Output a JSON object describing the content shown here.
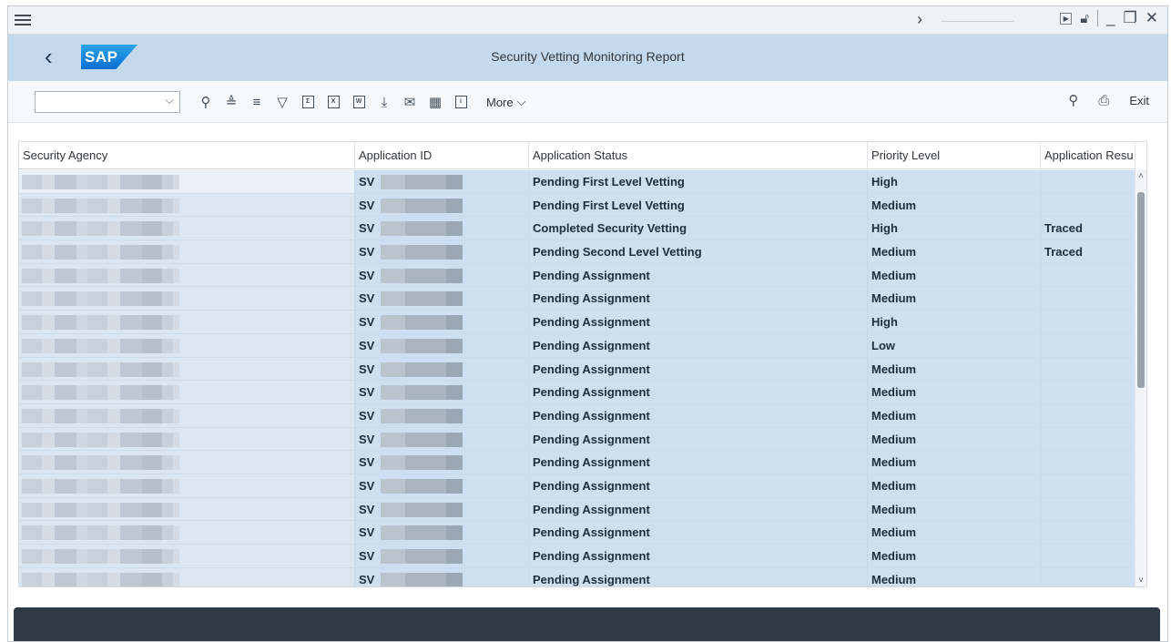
{
  "title": "Security Vetting Monitoring Report",
  "logo_text": "SAP",
  "toolbar": {
    "more_label": "More",
    "exit_label": "Exit"
  },
  "table": {
    "headers": [
      "Security Agency",
      "Application ID",
      "Application Status",
      "Priority Level",
      "Application Resu"
    ],
    "rows": [
      {
        "id": "SV",
        "status": "Pending First Level Vetting",
        "priority": "High",
        "result": ""
      },
      {
        "id": "SV",
        "status": "Pending First Level Vetting",
        "priority": "Medium",
        "result": ""
      },
      {
        "id": "SV",
        "status": "Completed Security Vetting",
        "priority": "High",
        "result": "Traced"
      },
      {
        "id": "SV",
        "status": "Pending Second Level Vetting",
        "priority": "Medium",
        "result": "Traced"
      },
      {
        "id": "SV",
        "status": "Pending Assignment",
        "priority": "Medium",
        "result": ""
      },
      {
        "id": "SV",
        "status": "Pending Assignment",
        "priority": "Medium",
        "result": ""
      },
      {
        "id": "SV",
        "status": "Pending Assignment",
        "priority": "High",
        "result": ""
      },
      {
        "id": "SV",
        "status": "Pending Assignment",
        "priority": "Low",
        "result": ""
      },
      {
        "id": "SV",
        "status": "Pending Assignment",
        "priority": "Medium",
        "result": ""
      },
      {
        "id": "SV",
        "status": "Pending Assignment",
        "priority": "Medium",
        "result": ""
      },
      {
        "id": "SV",
        "status": "Pending Assignment",
        "priority": "Medium",
        "result": ""
      },
      {
        "id": "SV",
        "status": "Pending Assignment",
        "priority": "Medium",
        "result": ""
      },
      {
        "id": "SV",
        "status": "Pending Assignment",
        "priority": "Medium",
        "result": ""
      },
      {
        "id": "SV",
        "status": "Pending Assignment",
        "priority": "Medium",
        "result": ""
      },
      {
        "id": "SV",
        "status": "Pending Assignment",
        "priority": "Medium",
        "result": ""
      },
      {
        "id": "SV",
        "status": "Pending Assignment",
        "priority": "Medium",
        "result": ""
      },
      {
        "id": "SV",
        "status": "Pending Assignment",
        "priority": "Medium",
        "result": ""
      },
      {
        "id": "SV",
        "status": "Pending Assignment",
        "priority": "Medium",
        "result": ""
      }
    ]
  },
  "colors": {
    "title_bar": "#c5d9ec",
    "row_selected": "#cddff0",
    "footer": "#2e3a46"
  }
}
